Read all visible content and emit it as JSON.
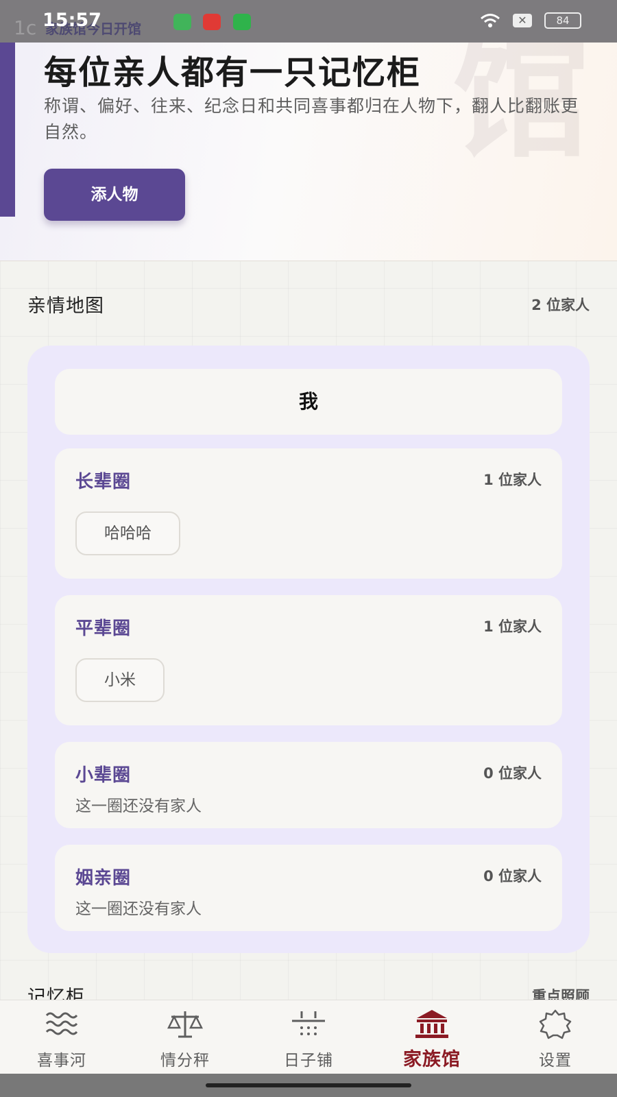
{
  "status_bar": {
    "time": "15:57",
    "overlap_text": "家族馆今日开馆",
    "battery": "84"
  },
  "hero": {
    "watermark": "馆",
    "title": "每位亲人都有一只记忆柜",
    "subtitle": "称谓、偏好、往来、纪念日和共同喜事都归在人物下，翻人比翻账更自然。",
    "add_button": "添人物",
    "accent_color": "#5b4893"
  },
  "kinship_map": {
    "title": "亲情地图",
    "count": "2 位家人",
    "me": "我",
    "circles": [
      {
        "name": "长辈圈",
        "count": "1 位家人",
        "members": [
          "哈哈哈"
        ]
      },
      {
        "name": "平辈圈",
        "count": "1 位家人",
        "members": [
          "小米"
        ]
      },
      {
        "name": "小辈圈",
        "count": "0 位家人",
        "empty_text": "这一圈还没有家人"
      },
      {
        "name": "姻亲圈",
        "count": "0 位家人",
        "empty_text": "这一圈还没有家人"
      }
    ]
  },
  "memory_cabinet": {
    "title": "记忆柜",
    "meta": "重点照顾"
  },
  "bottom_nav": {
    "items": [
      {
        "label": "喜事河",
        "icon": "waves-icon",
        "active": false
      },
      {
        "label": "情分秤",
        "icon": "scale-icon",
        "active": false
      },
      {
        "label": "日子铺",
        "icon": "calendar-grid-icon",
        "active": false
      },
      {
        "label": "家族馆",
        "icon": "museum-icon",
        "active": true
      },
      {
        "label": "设置",
        "icon": "gear-icon",
        "active": false
      }
    ],
    "active_color": "#8b1b24"
  }
}
